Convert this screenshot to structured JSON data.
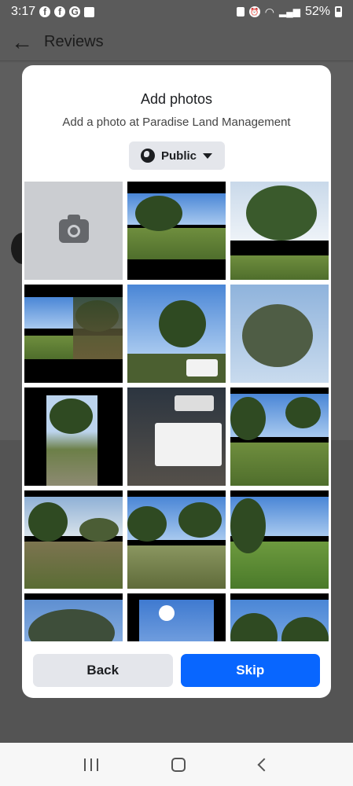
{
  "status_bar": {
    "time": "3:17",
    "notification_icons": [
      "facebook-icon",
      "facebook-icon",
      "google-icon",
      "gallery-icon"
    ],
    "battery": "52%"
  },
  "background": {
    "header_title": "Reviews"
  },
  "modal": {
    "title": "Add photos",
    "subtitle": "Add a photo at Paradise Land Management",
    "privacy_label": "Public",
    "back_label": "Back",
    "skip_label": "Skip"
  },
  "colors": {
    "primary": "#0866ff",
    "secondary_button": "#e4e6eb",
    "overlay": "#5b5b5b"
  }
}
